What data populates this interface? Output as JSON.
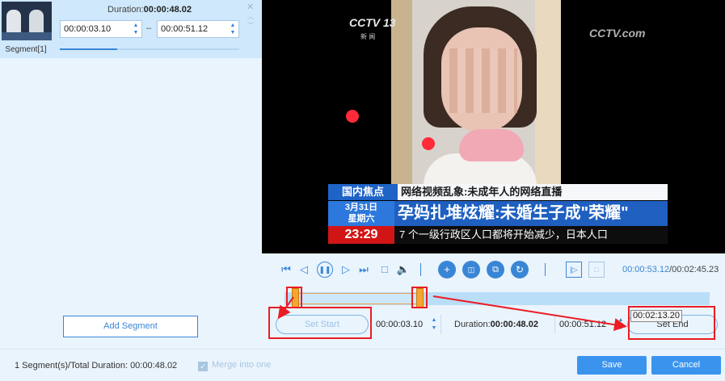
{
  "segment_panel": {
    "duration_prefix": "Duration:",
    "duration_value": "00:00:48.02",
    "segment_label": "Segment[1]",
    "start_time": "00:00:03.10",
    "end_time": "00:00:51.12",
    "separator": "–",
    "progress_fraction": 0.32,
    "add_segment_label": "Add Segment"
  },
  "video": {
    "channel_logo": "CCTV 13",
    "channel_sub": "新 闻",
    "watermark": "CCTV.com",
    "ticker_tag": "国内焦点",
    "ticker_line1": "网络视频乱象:未成年人的网络直播",
    "ticker_date_1": "3月31日",
    "ticker_date_2": "星期六",
    "ticker_headline": "孕妈扎堆炫耀:未婚生子成\"荣耀\"",
    "ticker_clock": "23:29",
    "ticker_line3": "7 个一级行政区人口都将开始减少，日本人口"
  },
  "controls": {
    "current_time": "00:00:53.12",
    "total_time": "/00:02:45.23",
    "icons": [
      "skip-start-icon",
      "step-back-icon",
      "pause-icon",
      "step-forward-icon",
      "skip-end-icon",
      "stop-icon",
      "volume-icon",
      "add-icon",
      "split-icon",
      "copy-icon",
      "reset-icon",
      "mark-in-icon",
      "mark-out-icon"
    ]
  },
  "trim": {
    "set_start_label": "Set Start",
    "start_time": "00:00:03.10",
    "duration_prefix": "Duration:",
    "duration_value": "00:00:48.02",
    "end_time": "00:00:51.12",
    "set_end_label": "Set End",
    "tooltip": "00:02:13.20"
  },
  "footer": {
    "summary": "1 Segment(s)/Total Duration: 00:00:48.02",
    "merge_label": "Merge into one",
    "save_label": "Save",
    "cancel_label": "Cancel"
  },
  "colors": {
    "accent": "#3a86d6",
    "annotation": "#ea1c24",
    "handle": "#f7a531"
  }
}
